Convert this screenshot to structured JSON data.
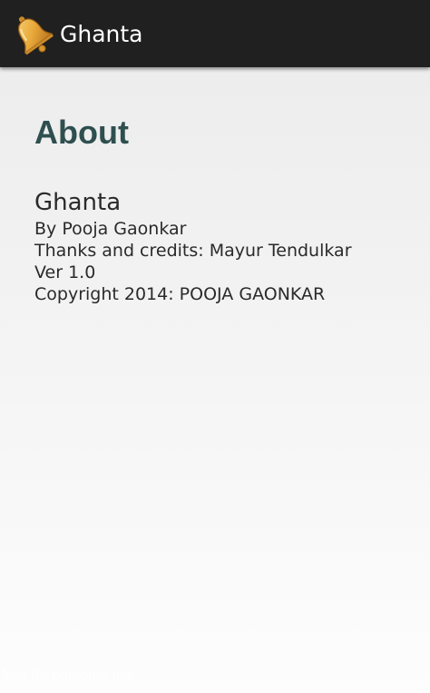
{
  "action_bar": {
    "title": "Ghanta",
    "icon": "bell-icon"
  },
  "about": {
    "heading": "About",
    "app_name": "Ghanta",
    "author": "By Pooja Gaonkar",
    "credits": "Thanks and credits: Mayur Tendulkar",
    "version": "Ver 1.0",
    "copyright": "Copyright 2014: POOJA GAONKAR"
  },
  "watermark": "free for personal use",
  "colors": {
    "action_bar_bg": "#202020",
    "heading": "#2f4f4f",
    "bell_gold": "#e8a93a"
  }
}
